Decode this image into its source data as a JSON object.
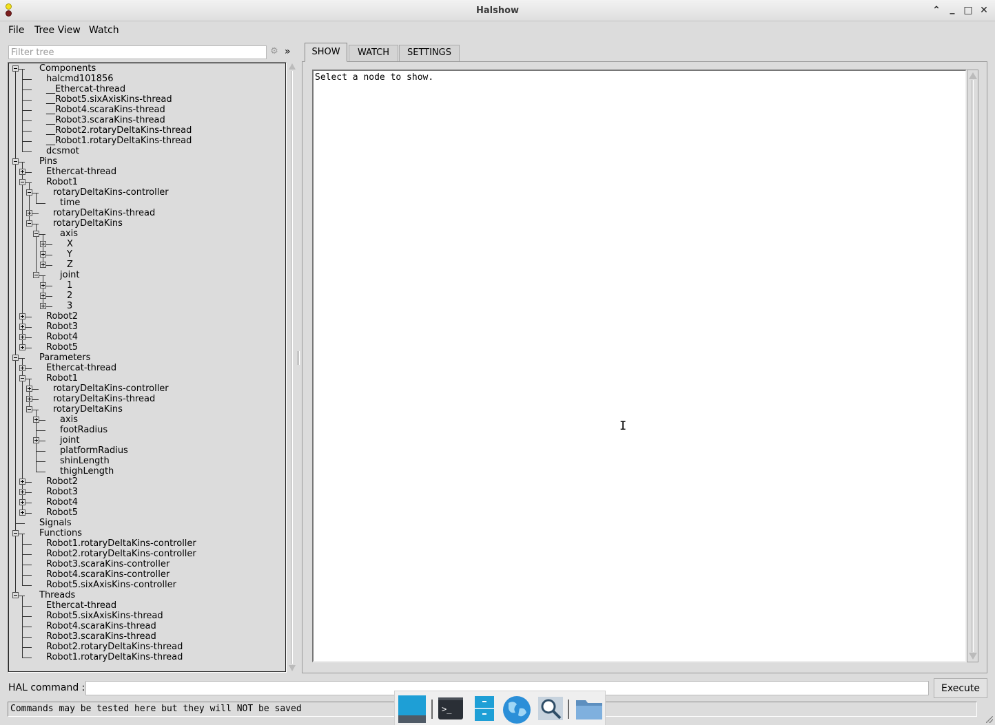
{
  "window": {
    "title": "Halshow"
  },
  "menubar": {
    "items": [
      "File",
      "Tree View",
      "Watch"
    ]
  },
  "filter": {
    "placeholder": "Filter tree",
    "more_label": "»"
  },
  "tree": {
    "rows": [
      {
        "label": "Components",
        "depth": 0,
        "box": "minus"
      },
      {
        "label": "halcmd101856",
        "depth": 1
      },
      {
        "label": "__Ethercat-thread",
        "depth": 1
      },
      {
        "label": "__Robot5.sixAxisKins-thread",
        "depth": 1
      },
      {
        "label": "__Robot4.scaraKins-thread",
        "depth": 1
      },
      {
        "label": "__Robot3.scaraKins-thread",
        "depth": 1
      },
      {
        "label": "__Robot2.rotaryDeltaKins-thread",
        "depth": 1
      },
      {
        "label": "__Robot1.rotaryDeltaKins-thread",
        "depth": 1
      },
      {
        "label": "dcsmot",
        "depth": 1
      },
      {
        "label": "Pins",
        "depth": 0,
        "box": "minus"
      },
      {
        "label": "Ethercat-thread",
        "depth": 1,
        "box": "plus"
      },
      {
        "label": "Robot1",
        "depth": 1,
        "box": "minus"
      },
      {
        "label": "rotaryDeltaKins-controller",
        "depth": 2,
        "box": "minus"
      },
      {
        "label": "time",
        "depth": 3
      },
      {
        "label": "rotaryDeltaKins-thread",
        "depth": 2,
        "box": "plus"
      },
      {
        "label": "rotaryDeltaKins",
        "depth": 2,
        "box": "minus"
      },
      {
        "label": "axis",
        "depth": 3,
        "box": "minus"
      },
      {
        "label": "X",
        "depth": 4,
        "box": "plus"
      },
      {
        "label": "Y",
        "depth": 4,
        "box": "plus"
      },
      {
        "label": "Z",
        "depth": 4,
        "box": "plus"
      },
      {
        "label": "joint",
        "depth": 3,
        "box": "minus"
      },
      {
        "label": "1",
        "depth": 4,
        "box": "plus"
      },
      {
        "label": "2",
        "depth": 4,
        "box": "plus"
      },
      {
        "label": "3",
        "depth": 4,
        "box": "plus"
      },
      {
        "label": "Robot2",
        "depth": 1,
        "box": "plus"
      },
      {
        "label": "Robot3",
        "depth": 1,
        "box": "plus"
      },
      {
        "label": "Robot4",
        "depth": 1,
        "box": "plus"
      },
      {
        "label": "Robot5",
        "depth": 1,
        "box": "plus"
      },
      {
        "label": "Parameters",
        "depth": 0,
        "box": "minus"
      },
      {
        "label": "Ethercat-thread",
        "depth": 1,
        "box": "plus"
      },
      {
        "label": "Robot1",
        "depth": 1,
        "box": "minus"
      },
      {
        "label": "rotaryDeltaKins-controller",
        "depth": 2,
        "box": "plus"
      },
      {
        "label": "rotaryDeltaKins-thread",
        "depth": 2,
        "box": "plus"
      },
      {
        "label": "rotaryDeltaKins",
        "depth": 2,
        "box": "minus"
      },
      {
        "label": "axis",
        "depth": 3,
        "box": "plus"
      },
      {
        "label": "footRadius",
        "depth": 3
      },
      {
        "label": "joint",
        "depth": 3,
        "box": "plus"
      },
      {
        "label": "platformRadius",
        "depth": 3
      },
      {
        "label": "shinLength",
        "depth": 3
      },
      {
        "label": "thighLength",
        "depth": 3
      },
      {
        "label": "Robot2",
        "depth": 1,
        "box": "plus"
      },
      {
        "label": "Robot3",
        "depth": 1,
        "box": "plus"
      },
      {
        "label": "Robot4",
        "depth": 1,
        "box": "plus"
      },
      {
        "label": "Robot5",
        "depth": 1,
        "box": "plus"
      },
      {
        "label": "Signals",
        "depth": 0
      },
      {
        "label": "Functions",
        "depth": 0,
        "box": "minus"
      },
      {
        "label": "Robot1.rotaryDeltaKins-controller",
        "depth": 1
      },
      {
        "label": "Robot2.rotaryDeltaKins-controller",
        "depth": 1
      },
      {
        "label": "Robot3.scaraKins-controller",
        "depth": 1
      },
      {
        "label": "Robot4.scaraKins-controller",
        "depth": 1
      },
      {
        "label": "Robot5.sixAxisKins-controller",
        "depth": 1
      },
      {
        "label": "Threads",
        "depth": 0,
        "box": "minus"
      },
      {
        "label": "Ethercat-thread",
        "depth": 1
      },
      {
        "label": "Robot5.sixAxisKins-thread",
        "depth": 1
      },
      {
        "label": "Robot4.scaraKins-thread",
        "depth": 1
      },
      {
        "label": "Robot3.scaraKins-thread",
        "depth": 1
      },
      {
        "label": "Robot2.rotaryDeltaKins-thread",
        "depth": 1
      },
      {
        "label": "Robot1.rotaryDeltaKins-thread",
        "depth": 1
      }
    ]
  },
  "tabs": {
    "show": "SHOW",
    "watch": "WATCH",
    "settings": "SETTINGS",
    "active": "SHOW"
  },
  "show_panel": {
    "text": "Select a node to show."
  },
  "hal": {
    "label": "HAL command :",
    "value": "",
    "execute_label": "Execute",
    "status": "Commands may be tested here but they will NOT be saved"
  },
  "dock": {
    "items": [
      "desktop-icon",
      "terminal-icon",
      "file-cabinet-icon",
      "web-browser-icon",
      "search-icon",
      "folder-icon"
    ]
  },
  "colors": {
    "dock_blue": "#1e9fd6",
    "window_bg": "#dcdcdc"
  }
}
